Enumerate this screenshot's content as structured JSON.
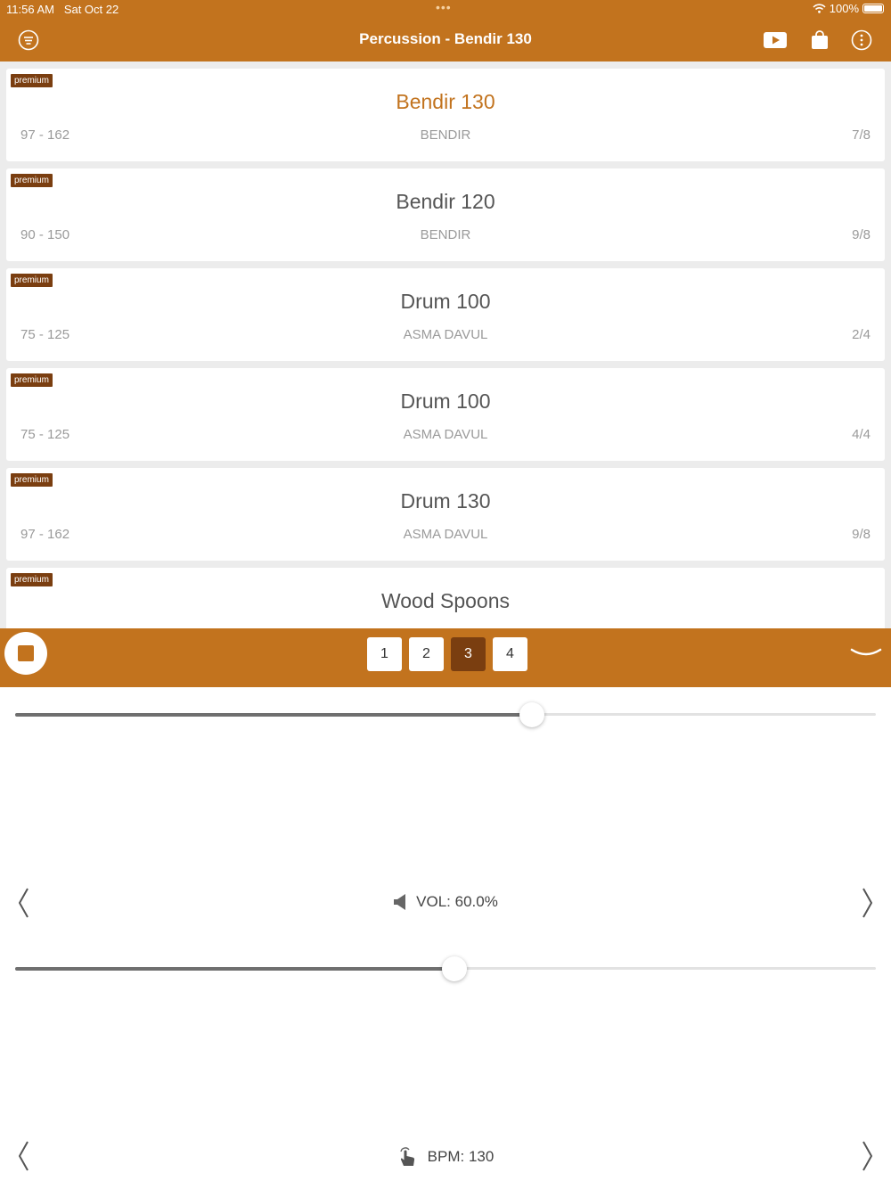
{
  "status_bar": {
    "time": "11:56 AM",
    "date": "Sat Oct 22",
    "dots": "•••",
    "battery": "100%"
  },
  "nav": {
    "title": "Percussion - Bendir 130"
  },
  "rows": [
    {
      "badge": "premium",
      "title": "Bendir 130",
      "range": "97 - 162",
      "instrument": "BENDIR",
      "meter": "7/8",
      "active": true
    },
    {
      "badge": "premium",
      "title": "Bendir 120",
      "range": "90 - 150",
      "instrument": "BENDIR",
      "meter": "9/8"
    },
    {
      "badge": "premium",
      "title": "Drum 100",
      "range": "75 - 125",
      "instrument": "ASMA DAVUL",
      "meter": "2/4"
    },
    {
      "badge": "premium",
      "title": "Drum 100",
      "range": "75 - 125",
      "instrument": "ASMA DAVUL",
      "meter": "4/4"
    },
    {
      "badge": "premium",
      "title": "Drum 130",
      "range": "97 - 162",
      "instrument": "ASMA DAVUL",
      "meter": "9/8"
    },
    {
      "badge": "premium",
      "title": "Wood Spoons"
    }
  ],
  "player": {
    "pages": [
      "1",
      "2",
      "3",
      "4"
    ],
    "active_page": "3"
  },
  "progress": {
    "value": 0.6
  },
  "volume": {
    "label": "VOL: 60.0%",
    "value": 0.51
  },
  "bpm": {
    "label": "BPM: 130"
  },
  "colors": {
    "accent": "#c2731e",
    "badge": "#7a3e10",
    "active_page": "#7a3e10"
  },
  "icons": {
    "menu": "menu-icon",
    "video": "video-icon",
    "store": "shopping-bag-icon",
    "info": "info-icon",
    "volume": "speaker-icon",
    "tap": "tap-hand-icon"
  }
}
